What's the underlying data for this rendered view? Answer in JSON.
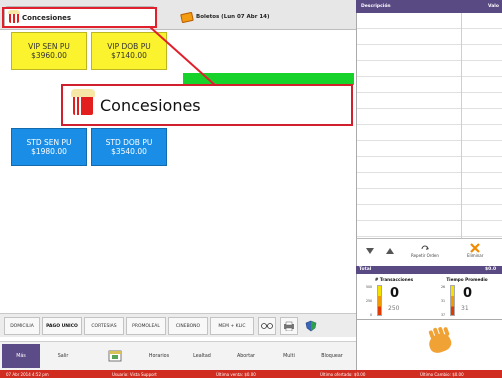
{
  "tabs": {
    "active": "Concesiones",
    "boletos": "Boletos (Lun 07 Abr 14)"
  },
  "zoom_label": "Concesiones",
  "products": [
    {
      "name": "VIP SEN PU",
      "price": "$3960.00",
      "color": "#fbf32d"
    },
    {
      "name": "VIP DOB PU",
      "price": "$7140.00",
      "color": "#fbf32d"
    },
    {
      "name": "STD SEN PU",
      "price": "$1980.00",
      "color": "#1a8ee6"
    },
    {
      "name": "STD DOB PU",
      "price": "$3540.00",
      "color": "#1a8ee6"
    }
  ],
  "options": [
    "DOMICILIA",
    "PAGO UNICO",
    "CORTESIAS",
    "PROMOLEAL",
    "CINEBONO",
    "MEM + KLIC"
  ],
  "nav": [
    "Más",
    "Salir",
    "Horarios",
    "Lealtad",
    "Abortar",
    "Multi",
    "Bloquear"
  ],
  "order_panel": {
    "col_description": "Descripción",
    "col_value": "Valo",
    "repeat_label": "Repetir Orden",
    "delete_label": "Eliminar",
    "total_label": "Total",
    "total_value": "$0.0"
  },
  "stats": {
    "transactions": {
      "title": "# Transacciones",
      "value": "0",
      "sub": "250",
      "scale_top": "500",
      "scale_mid": "250",
      "scale_bot": "0"
    },
    "avg_time": {
      "title": "Tiempo Promedio",
      "value": "0",
      "sub": "31",
      "scale_top": "26",
      "scale_mid": "31",
      "scale_bot": "37"
    }
  },
  "status": {
    "datetime": "07 Abr 2014 4:52 pm",
    "user": "Usuario: Vista Support",
    "last_sale": "Última venta: $0.00",
    "last_offered": "Último ofertado: $0.00",
    "last_change": "Último Cambio: $0.00"
  }
}
